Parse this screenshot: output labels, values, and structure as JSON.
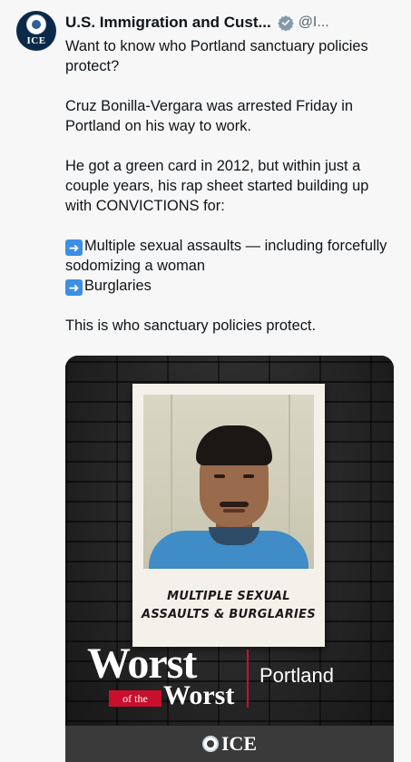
{
  "tweet": {
    "author_name": "U.S. Immigration and Cust...",
    "handle": "@I...",
    "avatar_text": "ICE",
    "paragraphs": {
      "p1": "Want to know who Portland sanctuary policies protect?",
      "p2": "Cruz Bonilla-Vergara was arrested Friday in Portland on his way to work.",
      "p3": "He got a green card in 2012, but within just a couple years, his rap sheet started building up with CONVICTIONS for:",
      "list_item_1": "Multiple sexual assaults — including forcefully sodomizing a woman",
      "list_item_2": "Burglaries",
      "p4": "This is who sanctuary policies protect."
    }
  },
  "media": {
    "caption_line1": "MULTIPLE SEXUAL",
    "caption_line2": "ASSAULTS & BURGLARIES",
    "logo_line1": "Worst",
    "logo_of_the": "of the",
    "logo_line2": "Worst",
    "city": "Portland",
    "footer_logo": "ICE"
  },
  "colors": {
    "verified_badge": "#829aab",
    "arrow_emoji": "#3d8fe3",
    "accent_red": "#c8102e",
    "agency_navy": "#0b2a4a"
  }
}
